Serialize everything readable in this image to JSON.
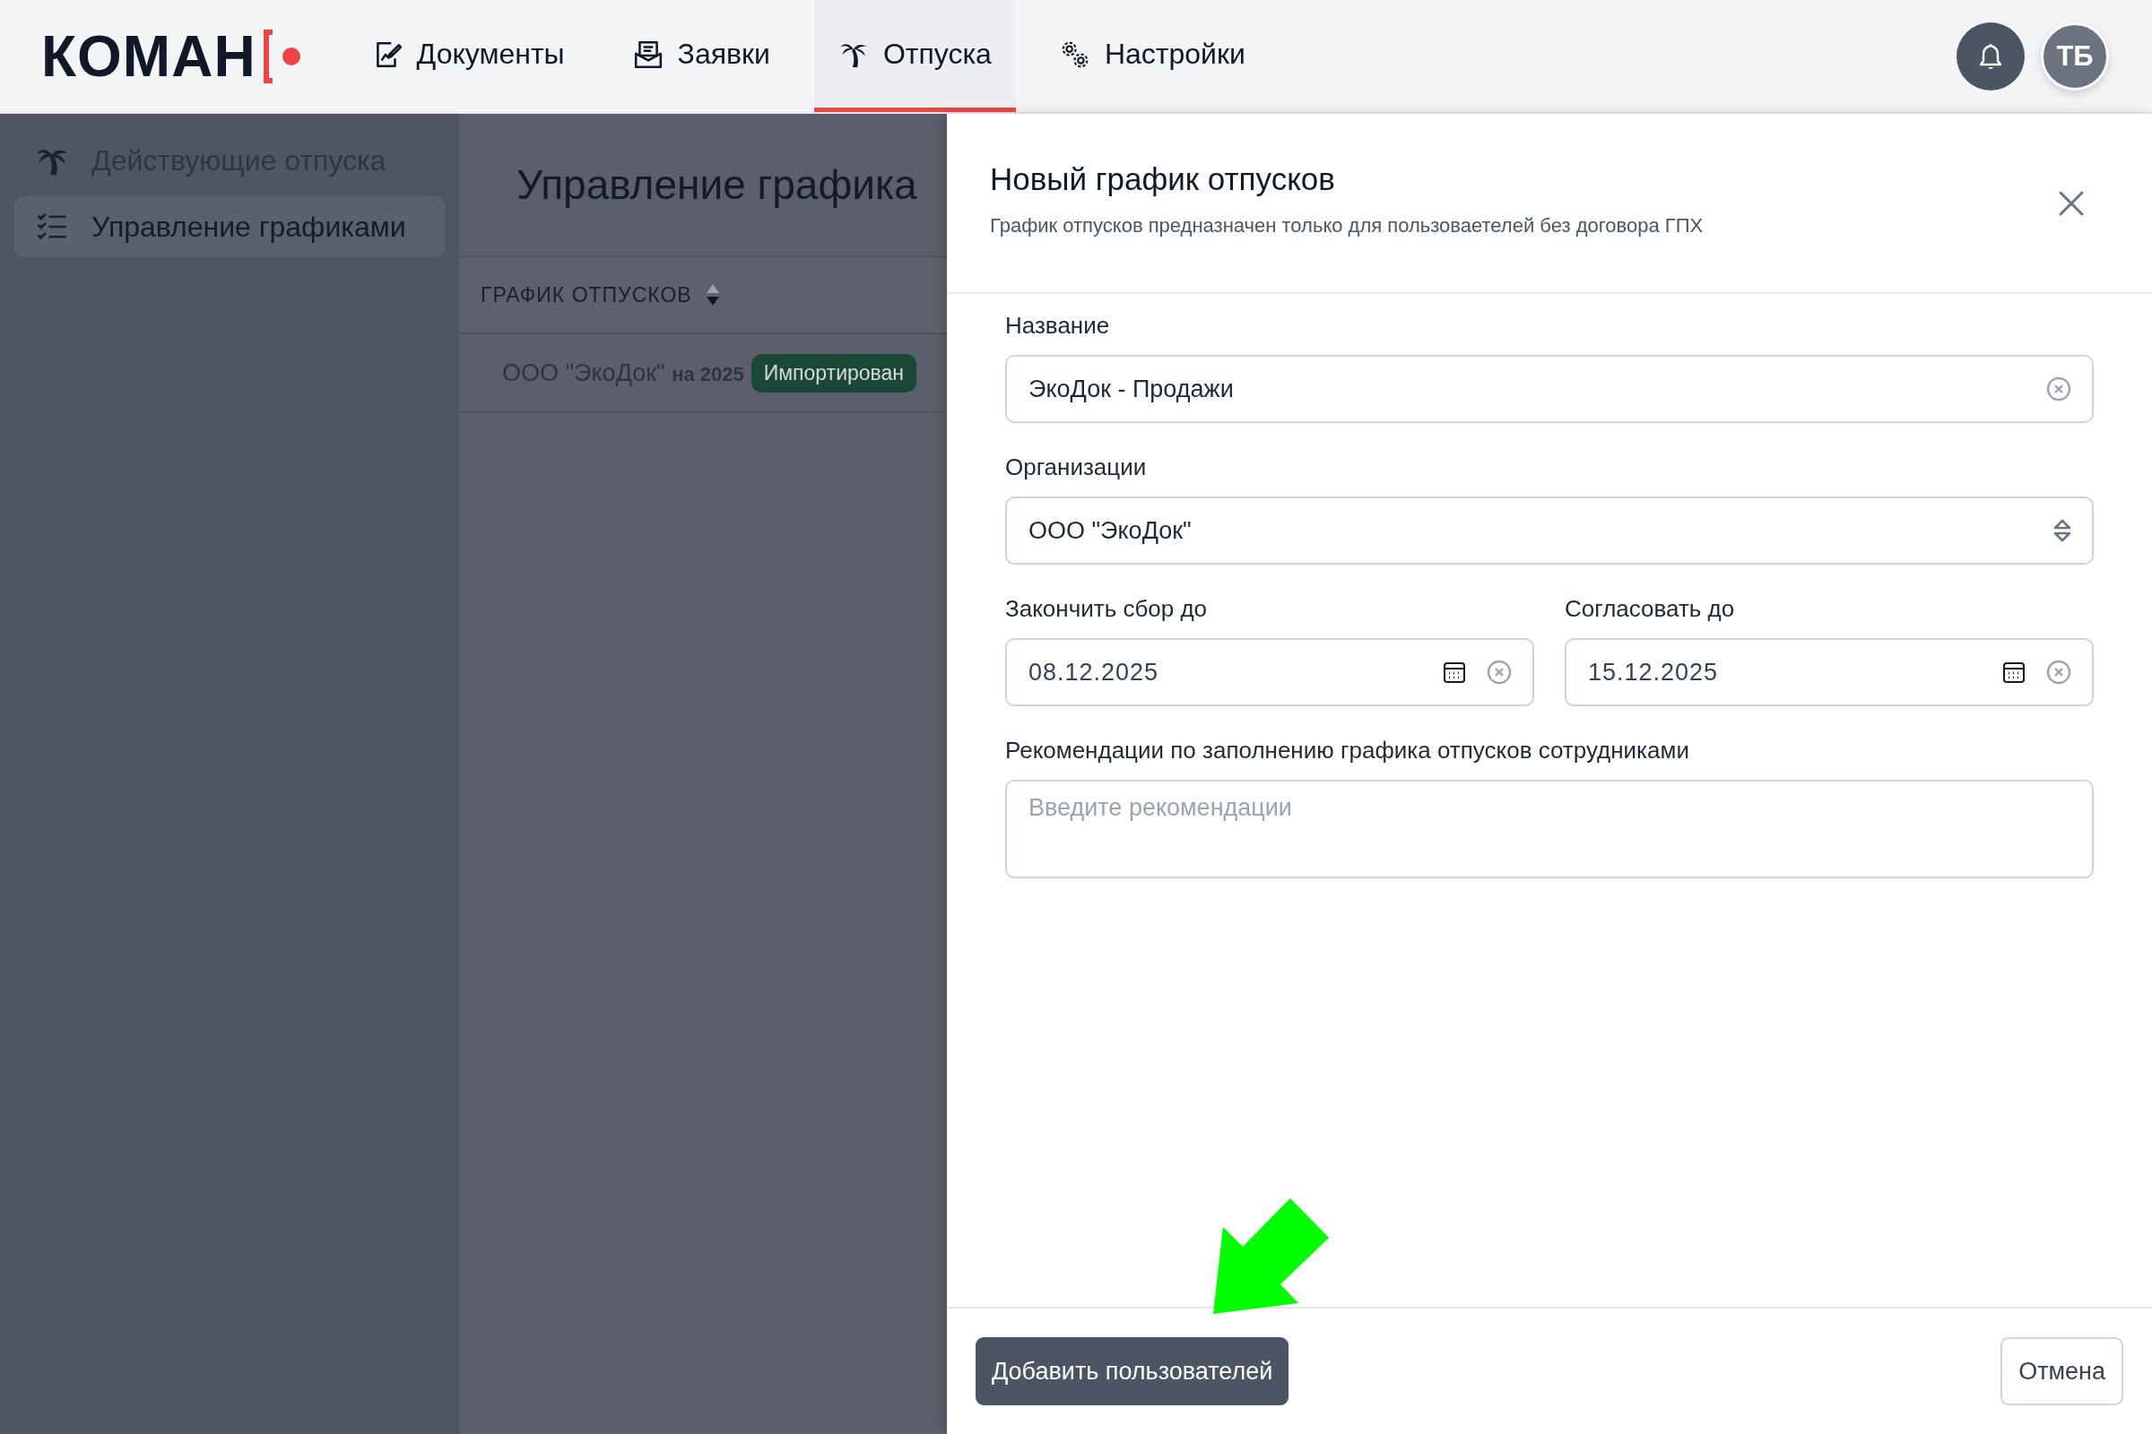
{
  "brand": {
    "name": "КОМАН"
  },
  "nav": [
    {
      "label": "Документы",
      "selected": false
    },
    {
      "label": "Заявки",
      "selected": false
    },
    {
      "label": "Отпуска",
      "selected": true
    },
    {
      "label": "Настройки",
      "selected": false
    }
  ],
  "avatar": {
    "initials": "ТБ"
  },
  "sidebar": {
    "items": [
      {
        "label": "Действующие отпуска",
        "selected": false
      },
      {
        "label": "Управление графиками",
        "selected": true
      }
    ]
  },
  "page": {
    "title": "Управление графика",
    "table": {
      "columns": [
        "ГРАФИК ОТПУСКОВ"
      ],
      "rows": [
        {
          "name": "ООО \"ЭкоДок\" **на 2025**",
          "status": "Импортирован"
        }
      ]
    }
  },
  "drawer": {
    "title": "Новый график отпусков",
    "subtitle": "График отпусков предназначен только для пользоваетелей без договора ГПХ",
    "fields": [
      {
        "kind": "text",
        "label": "Название",
        "value": "ЭкоДок - Продажи"
      },
      {
        "kind": "select",
        "label": "Организации",
        "value": "ООО \"ЭкоДок\""
      },
      {
        "kind": "date",
        "label": "Закончить сбор до",
        "value": "08.12.2025"
      },
      {
        "kind": "date",
        "label": "Согласовать до",
        "value": "15.12.2025"
      },
      {
        "kind": "textarea",
        "label": "Рекомендации по заполнению графика отпусков сотрудниками",
        "placeholder": "Введите рекомендации"
      }
    ],
    "buttons": [
      {
        "kind": "primary",
        "label": "Добавить пользователей"
      },
      {
        "kind": "secondary",
        "label": "Отмена"
      }
    ]
  }
}
